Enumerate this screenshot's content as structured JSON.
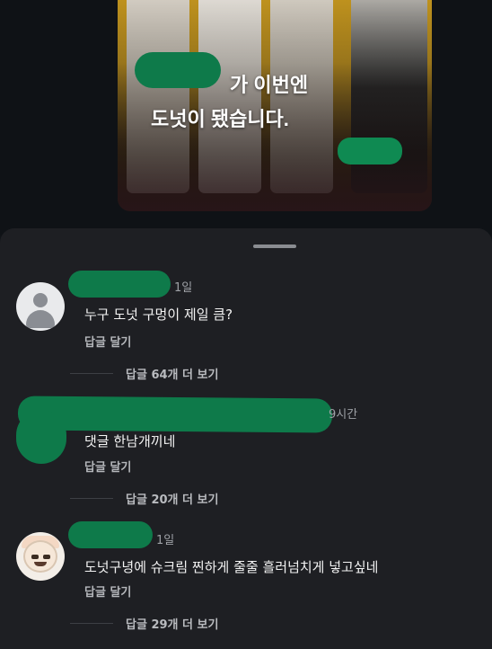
{
  "media": {
    "caption_line1": "가 이번엔",
    "caption_line2": "도넛이 됐습니다."
  },
  "comments": [
    {
      "time": "1일",
      "text": "누구 도넛 구멍이 제일 큼?",
      "reply_label": "답글 달기",
      "more_replies": "답글 64개 더 보기"
    },
    {
      "time": "9시간",
      "text": "댓글 한남개끼네",
      "reply_label": "답글 달기",
      "more_replies": "답글 20개 더 보기"
    },
    {
      "time": "1일",
      "text": "도넛구녕에 슈크림 찐하게 줄줄 흘러넘치게 넣고싶네",
      "reply_label": "답글 달기",
      "more_replies": "답글 29개 더 보기"
    }
  ],
  "colors": {
    "redaction": "#0e7a4a",
    "sheet_bg": "#1e1f23",
    "page_bg": "#111418"
  }
}
